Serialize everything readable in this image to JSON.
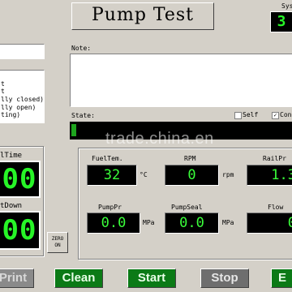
{
  "title": "Pump Test",
  "sys": {
    "label": "Sys",
    "value": "3"
  },
  "note": {
    "label": "Note:",
    "value": ""
  },
  "state": {
    "label": "State:",
    "value": "",
    "self_label": "Self",
    "con_label": "Con"
  },
  "left_field": {
    "value": ""
  },
  "left_list": {
    "items": [
      "t",
      "t",
      "lly closed)",
      "lly open)",
      "ting)"
    ]
  },
  "time_panel": {
    "label": "lTime",
    "value": "00"
  },
  "countdown_panel": {
    "label": "tDown",
    "value": "00"
  },
  "zero_button": {
    "line1": "ZERO",
    "line2": "ON"
  },
  "readouts": {
    "fueltem": {
      "label": "FuelTem.",
      "value": "32",
      "unit": "°C"
    },
    "rpm": {
      "label": "RPM",
      "value": "0",
      "unit": "rpm"
    },
    "railpr": {
      "label": "RailPr",
      "value": "1.3"
    },
    "pumppr": {
      "label": "PumpPr",
      "value": "0.0",
      "unit": "MPa"
    },
    "pumpseal": {
      "label": "PumpSeal",
      "value": "0.0",
      "unit": "MPa"
    },
    "flow": {
      "label": "Flow",
      "value": "0"
    }
  },
  "buttons": {
    "print": "Print",
    "clean": "Clean",
    "start": "Start",
    "stop": "Stop",
    "exit": "E"
  },
  "watermark": "trade.china.en"
}
